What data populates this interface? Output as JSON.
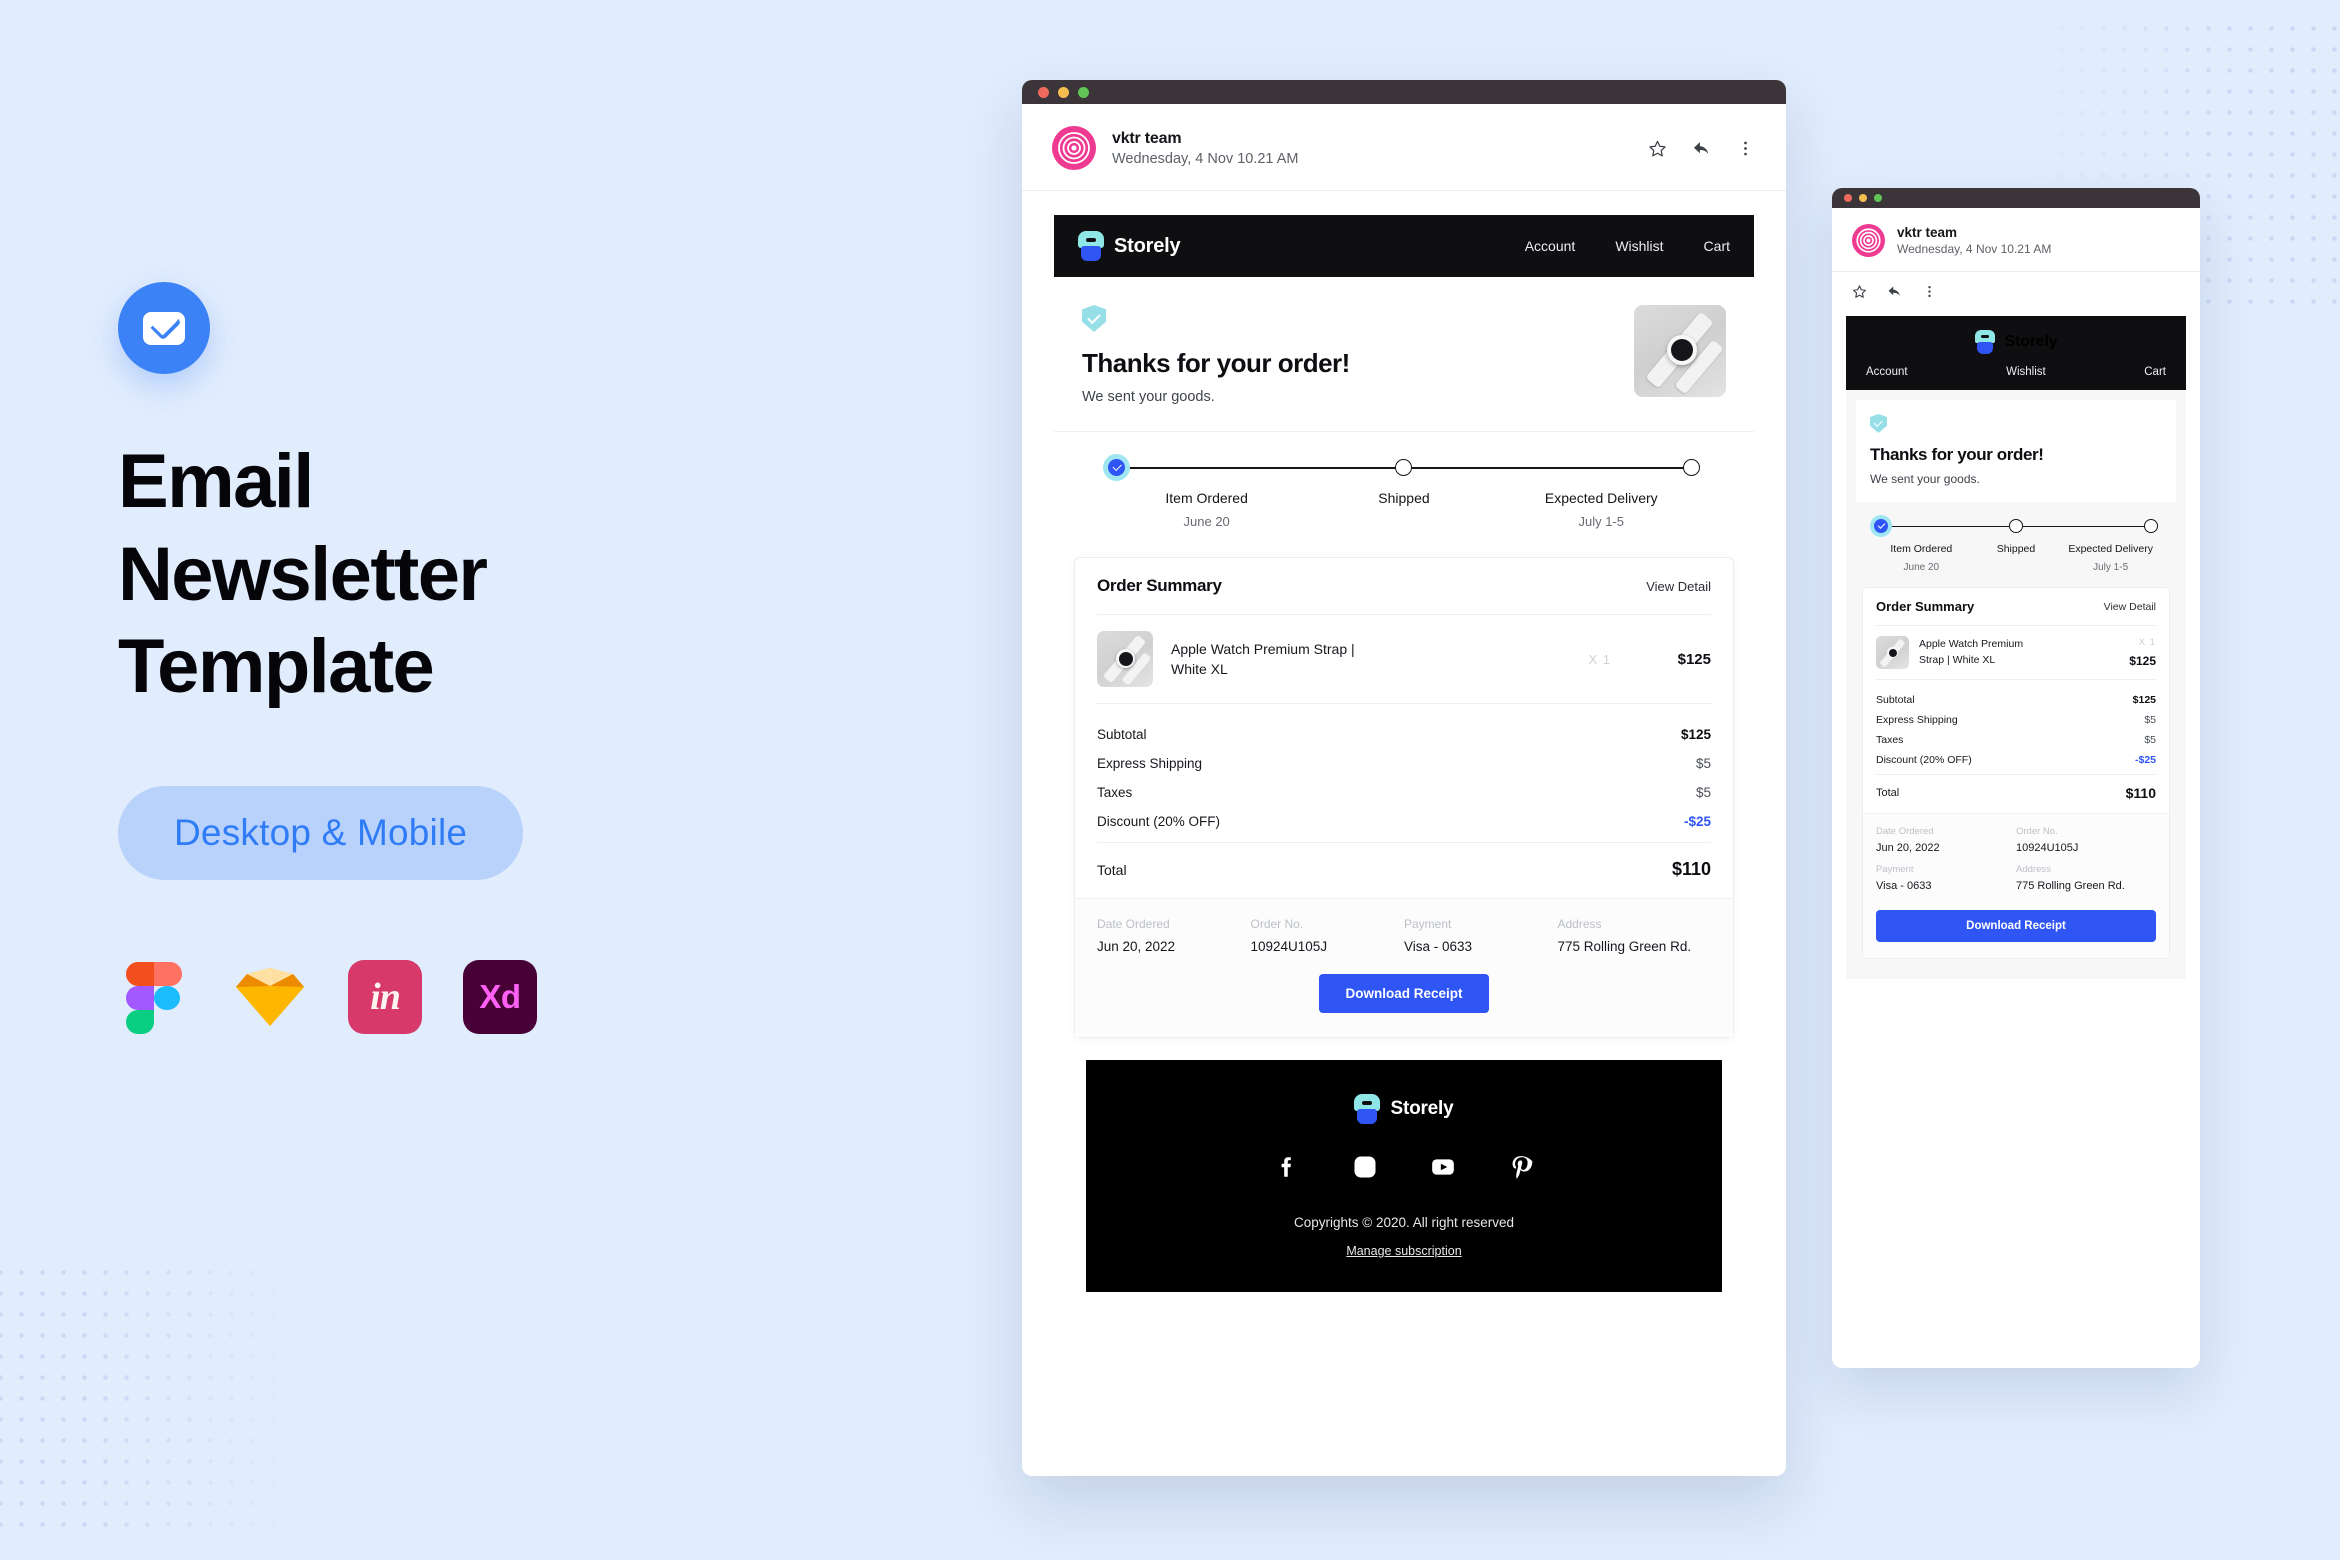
{
  "promo": {
    "mail_icon": "envelope-icon",
    "title_line1": "Email",
    "title_line2": "Newsletter",
    "title_line3": "Template",
    "pill_label": "Desktop & Mobile",
    "apps": [
      {
        "name": "figma-icon",
        "label": "Figma"
      },
      {
        "name": "sketch-icon",
        "label": "Sketch"
      },
      {
        "name": "invision-icon",
        "label": "in"
      },
      {
        "name": "adobe-xd-icon",
        "label": "Xd"
      }
    ]
  },
  "email": {
    "sender_name": "vktr team",
    "sent_at": "Wednesday, 4 Nov 10.21 AM",
    "actions": [
      {
        "name": "star-icon",
        "label": "Star"
      },
      {
        "name": "reply-icon",
        "label": "Reply"
      },
      {
        "name": "more-vertical-icon",
        "label": "More"
      }
    ]
  },
  "store": {
    "brand": "Storely",
    "nav": [
      {
        "label": "Account"
      },
      {
        "label": "Wishlist"
      },
      {
        "label": "Cart"
      }
    ]
  },
  "hero": {
    "heading": "Thanks for your order!",
    "subheading": "We sent your goods.",
    "badge_icon": "shield-check-icon",
    "product_image": "apple-watch-photo"
  },
  "tracker": {
    "steps": [
      {
        "title": "Item Ordered",
        "date": "June 20",
        "state": "done"
      },
      {
        "title": "Shipped",
        "date": "",
        "state": "pending"
      },
      {
        "title": "Expected Delivery",
        "date": "July 1-5",
        "state": "pending"
      }
    ],
    "mobile_steps": [
      {
        "title": "Item Ordered",
        "date": "June 20"
      },
      {
        "title": "Shipped",
        "date": ""
      },
      {
        "title": "Expected Delivery",
        "date": "July 1-5"
      }
    ]
  },
  "summary": {
    "title": "Order Summary",
    "view_detail": "View Detail",
    "item": {
      "name": "Apple Watch Premium Strap | White XL",
      "name_mobile_line1": "Apple Watch Premium",
      "name_mobile_line2": "Strap | White XL",
      "qty": "X 1",
      "price": "$125"
    },
    "rows": [
      {
        "label": "Subtotal",
        "value": "$125",
        "style": "bold"
      },
      {
        "label": "Express Shipping",
        "value": "$5",
        "style": "normal"
      },
      {
        "label": "Taxes",
        "value": "$5",
        "style": "normal"
      },
      {
        "label": "Discount (20% OFF)",
        "value": "-$25",
        "style": "accent"
      }
    ],
    "total_label": "Total",
    "total_value": "$110"
  },
  "meta": {
    "date_ordered_label": "Date Ordered",
    "date_ordered_value": "Jun 20, 2022",
    "order_no_label": "Order No.",
    "order_no_value": "10924U105J",
    "payment_label": "Payment",
    "payment_value": "Visa - 0633",
    "address_label": "Address",
    "address_value": "775 Rolling Green Rd."
  },
  "cta": {
    "download_label": "Download Receipt"
  },
  "footer": {
    "brand": "Storely",
    "socials": [
      {
        "name": "facebook-icon"
      },
      {
        "name": "instagram-icon"
      },
      {
        "name": "youtube-icon"
      },
      {
        "name": "pinterest-icon"
      }
    ],
    "copyright": "Copyrights © 2020. All right reserved",
    "manage": "Manage subscription"
  },
  "colors": {
    "background": "#e1ecfd",
    "accent_blue": "#2f55f5",
    "pill_bg": "#b9d2fb",
    "pill_text": "#2f7cf6",
    "dark_nav": "#0f0f11",
    "avatar_pink": "#ef3a92",
    "shield_teal": "#96dfe7",
    "logo_cyan": "#8fe6e6"
  }
}
